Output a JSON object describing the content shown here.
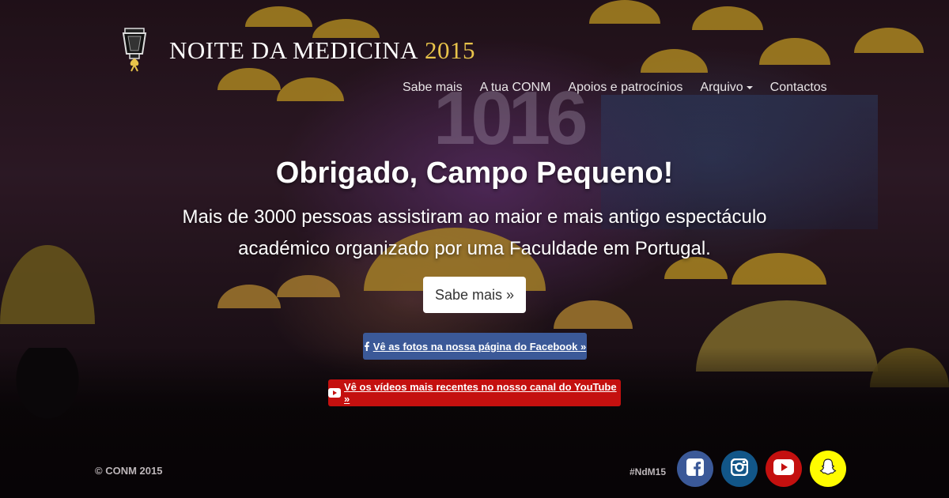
{
  "brand": {
    "name": "NOITE DA MEDICINA",
    "year": "2015"
  },
  "nav": {
    "items": [
      {
        "label": "Sabe mais"
      },
      {
        "label": "A tua CONM"
      },
      {
        "label": "Apoios e patrocínios"
      },
      {
        "label": "Arquivo"
      },
      {
        "label": "Contactos"
      }
    ]
  },
  "hero": {
    "headline": "Obrigado, Campo Pequeno!",
    "subtitle": "Mais de 3000 pessoas assistiram ao maior e mais antigo espectáculo académico organizado por uma Faculdade em Portugal.",
    "cta_label": "Sabe mais »",
    "stage_sign": "1016"
  },
  "buttons": {
    "facebook_label": "Vê as fotos na nossa página do Facebook »",
    "youtube_label": "Vê os vídeos mais recentes no nosso canal do YouTube »"
  },
  "footer": {
    "copyright": "© CONM 2015",
    "hashtag": "#NdM15"
  },
  "colors": {
    "facebook": "#3b5998",
    "instagram": "#125688",
    "youtube": "#c4100f",
    "snapchat": "#fffc00",
    "brand_year": "#e8c34a"
  }
}
